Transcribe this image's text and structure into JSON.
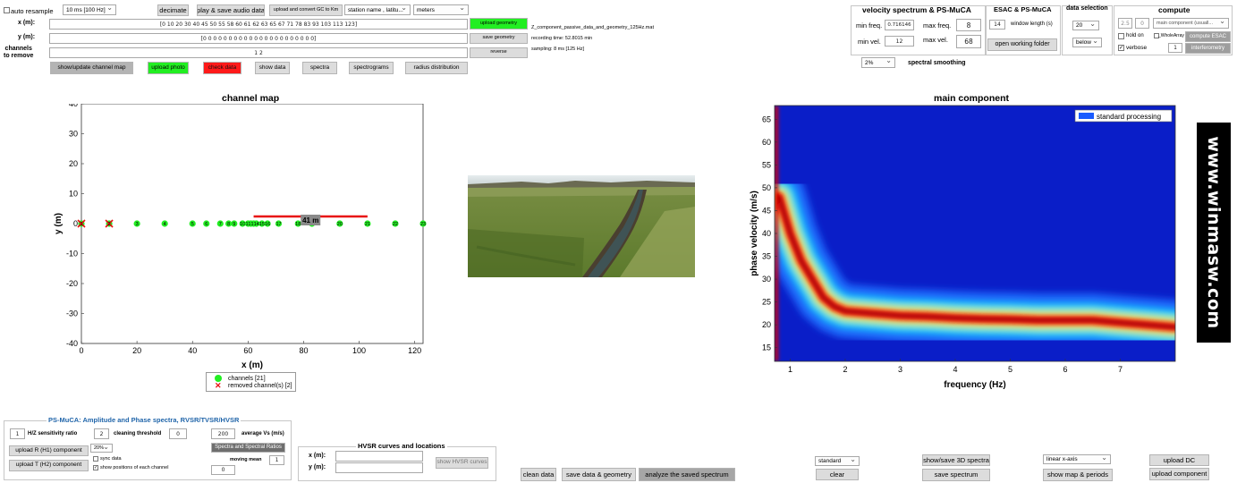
{
  "top": {
    "auto_resample": "auto resample",
    "resample_value": "10 ms [100 Hz]",
    "decimate": "decimate",
    "play_save": "play & save audio data",
    "upload_convert": "upload and convert GC to Km",
    "station_dd": "station name , latitu...",
    "units_dd": "meters",
    "x_label": "x (m):",
    "y_label": "y (m):",
    "channels_label": "channels\nto remove",
    "x_values": "[0  10  20  30  40  45  50  55  58  60  61  62  63  65  67  71  78  83  93  103  113  123]",
    "y_values": "[0 0 0 0 0 0 0 0 0 0 0 0 0 0 0 0 0 0 0 0 0 0]",
    "remove_values": "1 2",
    "upload_geometry": "upload geometry",
    "save_geometry": "save geometry",
    "reverse": "reverse",
    "file_name": "Z_component_passive_data_and_geometry_125Hz.mat",
    "recording_time": "recording time: 52.8015 min",
    "sampling": "sampling: 8 ms [125 Hz]",
    "btn_show_map": "show/update channel map",
    "btn_upload_photo": "upload photo",
    "btn_check_data": "check data",
    "btn_show_data": "show data",
    "btn_spectra": "spectra",
    "btn_spectrograms": "spectrograms",
    "btn_radius": "radius distribution"
  },
  "vs": {
    "title": "velocity spectrum & PS-MuCA",
    "min_freq_label": "min freq.",
    "min_freq": "0.716146",
    "max_freq_label": "max freq.",
    "max_freq": "8",
    "min_vel_label": "min vel.",
    "min_vel": "12",
    "max_vel_label": "max vel.",
    "max_vel": "68",
    "smoothing_value": "2%",
    "smoothing_label": "spectral smoothing"
  },
  "esac": {
    "title": "ESAC & PS-MuCA",
    "window_value": "14",
    "window_label": "window length (s)",
    "open_folder": "open working folder"
  },
  "ds": {
    "title": "data selection",
    "value": "20",
    "below": "below"
  },
  "compute": {
    "title": "compute",
    "v1": "2.5",
    "v2": "0",
    "mode": "main component (usuall...",
    "hold_on": "hold on",
    "whole": "_WholeArray",
    "compute_esac": "compute ESAC",
    "verbose": "verbose",
    "v3": "1",
    "interferometry": "interferometry"
  },
  "channel_map": {
    "title": "channel map",
    "xlabel": "x (m)",
    "ylabel": "y (m)",
    "span_label": "41 m",
    "legend_channels": "channels [21]",
    "legend_removed": "removed channel(s) [2]",
    "x_ticks": [
      "0",
      "20",
      "40",
      "60",
      "80",
      "100",
      "120"
    ],
    "y_ticks": [
      "40",
      "30",
      "20",
      "10",
      "0",
      "-10",
      "-20",
      "-30",
      "-40"
    ]
  },
  "main": {
    "title": "main component",
    "xlabel": "frequency (Hz)",
    "ylabel": "phase velocity (m/s)",
    "legend": "standard processing",
    "x_ticks": [
      "1",
      "2",
      "3",
      "4",
      "5",
      "6",
      "7"
    ],
    "y_ticks": [
      "65",
      "60",
      "55",
      "50",
      "45",
      "40",
      "35",
      "30",
      "25",
      "20",
      "15"
    ]
  },
  "logo": "www.winmasw.com",
  "psmuca": {
    "title": "PS-MuCA: Amplitude and Phase spectra, RVSR/TVSR/HVSR",
    "hz_value": "1",
    "hz_label": "H/Z sensitivity ratio",
    "clean_value": "2",
    "clean_label": "cleaning threshold",
    "clean_field": "0",
    "avg_value": "200",
    "avg_label": "average Vs (m/s)",
    "upload_r": "upload R (H1) component",
    "upload_t": "upload T (H2) component",
    "pct": "20%",
    "sync": "sync data",
    "show_positions": "show positions of each channel",
    "spectra_ratios": "Spectra and Spectral Ratios",
    "moving_mean": "moving mean",
    "mm_value": "1",
    "zero": "0"
  },
  "hvsr": {
    "title": "HVSR curves and locations",
    "x_label": "x (m):",
    "y_label": "y (m):",
    "show": "show HVSR curves"
  },
  "bottom": {
    "clean_data": "clean data",
    "save_data": "save data & geometry",
    "analyze": "analyze the saved spectrum",
    "standard": "standard",
    "clear": "clear",
    "show_save_3d": "show/save 3D spectra",
    "save_spectrum": "save spectrum",
    "linear": "linear x-axis",
    "show_map_periods": "show map & periods",
    "upload_dc": "upload DC",
    "upload_component": "upload component"
  },
  "colors": {
    "green": "#22ee22",
    "red": "#ff1a1a",
    "heat_bg": "#0a1ec8",
    "track": "#cc0000"
  },
  "chart_data": [
    {
      "type": "scatter",
      "title": "channel map",
      "xlabel": "x (m)",
      "ylabel": "y (m)",
      "xlim": [
        0,
        123
      ],
      "ylim": [
        -40,
        40
      ],
      "series": [
        {
          "name": "channels [21]",
          "x": [
            20,
            30,
            40,
            45,
            50,
            53,
            55,
            58,
            60,
            61,
            62,
            63,
            65,
            67,
            71,
            78,
            83,
            93,
            103,
            113,
            123
          ],
          "y": [
            0,
            0,
            0,
            0,
            0,
            0,
            0,
            0,
            0,
            0,
            0,
            0,
            0,
            0,
            0,
            0,
            0,
            0,
            0,
            0,
            0
          ],
          "labels": [
            "3",
            "4",
            "5",
            "6",
            "7",
            "8",
            "9",
            "10",
            "11",
            "12",
            "13",
            "14",
            "15",
            "16",
            "17",
            "18",
            "19",
            "20",
            "21",
            "22",
            "23"
          ]
        },
        {
          "name": "removed channel(s) [2]",
          "x": [
            0,
            10
          ],
          "y": [
            0,
            0
          ],
          "labels": [
            "1",
            "2"
          ]
        }
      ],
      "span": {
        "from": 62,
        "to": 103,
        "label": "41 m"
      }
    },
    {
      "type": "heatmap",
      "title": "main component",
      "xlabel": "frequency (Hz)",
      "ylabel": "phase velocity (m/s)",
      "xlim": [
        0.716146,
        8
      ],
      "ylim": [
        12,
        68
      ],
      "dispersion_curve": {
        "name": "standard processing",
        "freq": [
          0.8,
          1,
          1.2,
          1.4,
          1.6,
          1.8,
          2,
          2.5,
          3,
          3.5,
          4,
          4.5,
          5,
          5.5,
          6,
          6.5,
          7,
          7.5,
          8
        ],
        "velocity": [
          48,
          40,
          34,
          30,
          26,
          24,
          23,
          22.5,
          22,
          21.8,
          21.5,
          21.3,
          21.2,
          21,
          21,
          21,
          20.5,
          20,
          19.5
        ]
      }
    }
  ]
}
